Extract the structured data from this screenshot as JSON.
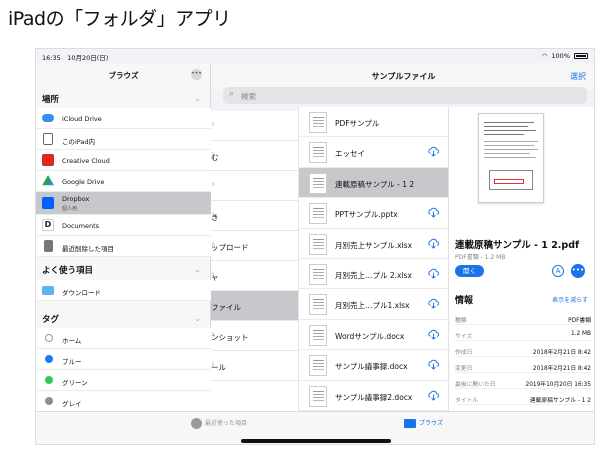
{
  "page_title": "iPadの「フォルダ」アプリ",
  "status": {
    "time": "16:35　10月20日(日)",
    "battery": "100%"
  },
  "sidebar": {
    "title": "ブラウズ",
    "more_icon": "ellipsis-icon",
    "locations_label": "場所",
    "locations": [
      {
        "label": "iCloud Drive",
        "icon": "cloud-icon",
        "color": "#3b8ded"
      },
      {
        "label": "このiPad内",
        "icon": "ipad-icon",
        "color": "#666666"
      },
      {
        "label": "Creative Cloud",
        "icon": "creative-cloud-icon",
        "color": "#d92a1c"
      },
      {
        "label": "Google Drive",
        "icon": "google-drive-icon",
        "color": "#1fa463"
      },
      {
        "label": "Dropbox",
        "sub": "個人用",
        "icon": "dropbox-icon",
        "color": "#0061fe",
        "selected": true
      },
      {
        "label": "Documents",
        "icon": "documents-icon",
        "color": "#222222"
      },
      {
        "label": "最近削除した項目",
        "icon": "trash-icon",
        "color": "#777777"
      }
    ],
    "favorites_label": "よく使う項目",
    "favorites": [
      {
        "label": "ダウンロード",
        "icon": "folder-icon",
        "color": "#5ab4f0"
      }
    ],
    "tags_label": "タグ",
    "tags": [
      {
        "label": "ホーム",
        "color": "#ffffff"
      },
      {
        "label": "ブルー",
        "color": "#1a7cf0"
      },
      {
        "label": "グリーン",
        "color": "#34c759"
      },
      {
        "label": "グレイ",
        "color": "#8e8e93"
      }
    ]
  },
  "navbar": {
    "title": "サンプルファイル",
    "select": "選択"
  },
  "search": {
    "placeholder": "検索"
  },
  "folder_column": [
    "",
    "む",
    "",
    "き",
    "ップロード",
    "ャ",
    "ファイル",
    "ンショット",
    "ール"
  ],
  "folder_selected_index": 6,
  "files": [
    {
      "name": "PDFサンプル",
      "cloud": false
    },
    {
      "name": "エッセイ",
      "cloud": true
    },
    {
      "name": "連載原稿サンプル - 1 2",
      "cloud": false,
      "selected": true
    },
    {
      "name": "PPTサンプル.pptx",
      "cloud": true
    },
    {
      "name": "月別売上サンプル.xlsx",
      "cloud": true
    },
    {
      "name": "月別売上…プル 2.xlsx",
      "cloud": true
    },
    {
      "name": "月別売上…プル1.xlsx",
      "cloud": true
    },
    {
      "name": "Wordサンプル.docx",
      "cloud": true
    },
    {
      "name": "サンプル議事録.docx",
      "cloud": true
    },
    {
      "name": "サンプル議事録2.docx",
      "cloud": true
    }
  ],
  "detail": {
    "name": "連載原稿サンプル - 1 2.pdf",
    "meta": "PDF書類 - 1.2 MB",
    "open": "開く",
    "info_title": "情報",
    "info_more": "表示を減らす",
    "info": [
      {
        "k": "種類",
        "v": "PDF書類"
      },
      {
        "k": "サイズ",
        "v": "1.2 MB"
      },
      {
        "k": "作成日",
        "v": "2018年2月21日 8:42"
      },
      {
        "k": "変更日",
        "v": "2018年2月21日 8:42"
      },
      {
        "k": "最後に開いた日",
        "v": "2019年10月20日 16:35"
      },
      {
        "k": "タイトル",
        "v": "連載原稿サンプル - 1 2"
      }
    ]
  },
  "tabbar": {
    "recent": "最近使った項目",
    "browse": "ブラウズ"
  }
}
